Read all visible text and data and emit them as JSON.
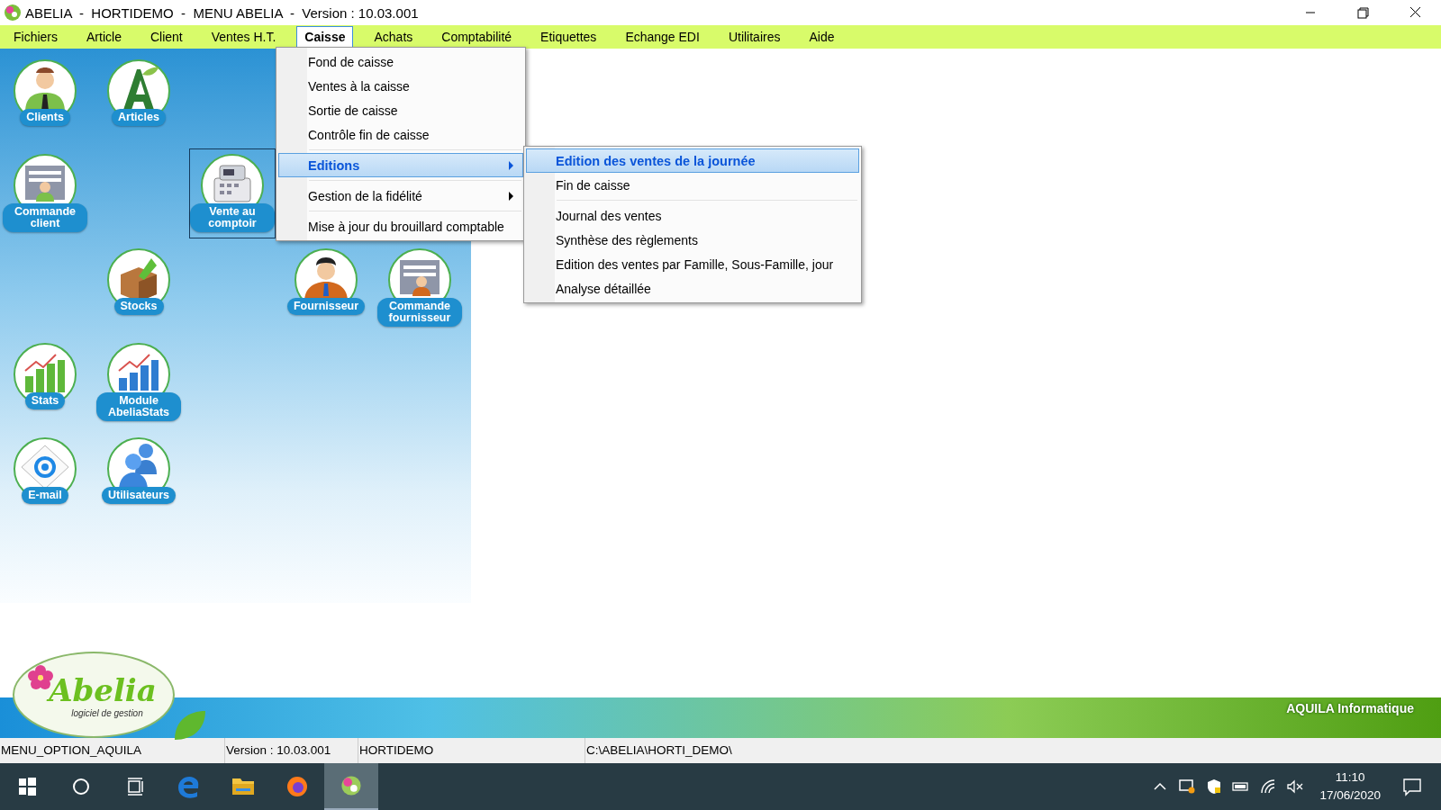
{
  "window": {
    "title": "ABELIA  -  HORTIDEMO  -  MENU ABELIA  -  Version : 10.03.001"
  },
  "menu_bar": [
    {
      "label": "Fichiers",
      "selected": false
    },
    {
      "label": "Article",
      "selected": false
    },
    {
      "label": "Client",
      "selected": false
    },
    {
      "label": "Ventes H.T.",
      "selected": false
    },
    {
      "label": "Caisse",
      "selected": true
    },
    {
      "label": "Achats",
      "selected": false
    },
    {
      "label": "Comptabilité",
      "selected": false
    },
    {
      "label": "Etiquettes",
      "selected": false
    },
    {
      "label": "Echange EDI",
      "selected": false
    },
    {
      "label": "Utilitaires",
      "selected": false
    },
    {
      "label": "Aide",
      "selected": false
    }
  ],
  "shortcuts": [
    {
      "label": "Clients",
      "selected": false
    },
    {
      "label": "Articles",
      "selected": false
    },
    {
      "label": "Commande client",
      "selected": false
    },
    {
      "label": "Vente au comptoir",
      "selected": true
    },
    {
      "label": "Stocks",
      "selected": false
    },
    {
      "label": "Fournisseur",
      "selected": false
    },
    {
      "label": "Commande fournisseur",
      "selected": false
    },
    {
      "label": "Stats",
      "selected": false
    },
    {
      "label": "Module AbeliaStats",
      "selected": false
    },
    {
      "label": "E-mail",
      "selected": false
    },
    {
      "label": "Utilisateurs",
      "selected": false
    }
  ],
  "caisse_menu": [
    {
      "kind": "item",
      "label": "Fond de caisse",
      "selected": false
    },
    {
      "kind": "item",
      "label": "Ventes à la caisse",
      "selected": false
    },
    {
      "kind": "item",
      "label": "Sortie de caisse",
      "selected": false
    },
    {
      "kind": "item",
      "label": "Contrôle fin de caisse",
      "selected": false
    },
    {
      "kind": "separator"
    },
    {
      "kind": "submenu",
      "label": "Editions",
      "selected": true
    },
    {
      "kind": "separator"
    },
    {
      "kind": "submenu",
      "label": "Gestion de la fidélité",
      "selected": false
    },
    {
      "kind": "separator"
    },
    {
      "kind": "item",
      "label": "Mise à jour du brouillard comptable",
      "selected": false
    }
  ],
  "editions_submenu": [
    {
      "kind": "item",
      "label": "Edition des ventes de la journée",
      "selected": true
    },
    {
      "kind": "item",
      "label": "Fin de caisse",
      "selected": false
    },
    {
      "kind": "separator"
    },
    {
      "kind": "item",
      "label": "Journal des ventes",
      "selected": false
    },
    {
      "kind": "item",
      "label": "Synthèse des règlements",
      "selected": false
    },
    {
      "kind": "item",
      "label": "Edition des ventes par Famille, Sous-Famille, jour",
      "selected": false
    },
    {
      "kind": "item",
      "label": "Analyse détaillée",
      "selected": false
    }
  ],
  "logo": {
    "name": "Abelia",
    "tagline": "logiciel de gestion"
  },
  "banner": {
    "company": "AQUILA Informatique"
  },
  "status_bar": [
    "MENU_OPTION_AQUILA",
    "Version : 10.03.001",
    "HORTIDEMO",
    "C:\\ABELIA\\HORTI_DEMO\\"
  ],
  "taskbar": {
    "time": "11:10",
    "date": "17/06/2020"
  }
}
